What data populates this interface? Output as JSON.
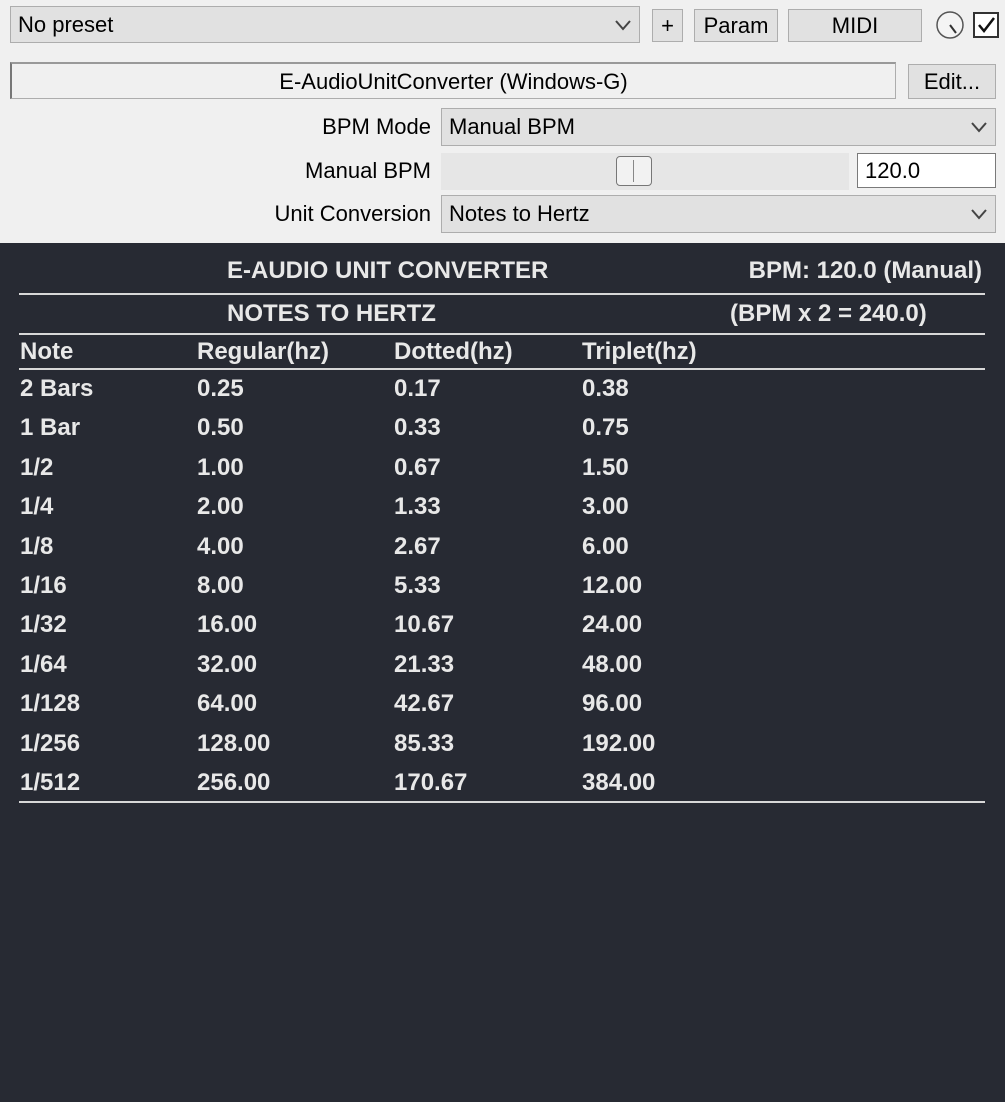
{
  "toolbar": {
    "preset": "No preset",
    "plus_label": "+",
    "param_label": "Param",
    "midi_label": "MIDI",
    "enabled": true
  },
  "plugin": {
    "name": "E-AudioUnitConverter (Windows-G)",
    "edit_label": "Edit..."
  },
  "params": {
    "bpm_mode_label": "BPM Mode",
    "bpm_mode_value": "Manual BPM",
    "manual_bpm_label": "Manual BPM",
    "manual_bpm_value": "120.0",
    "unit_conversion_label": "Unit Conversion",
    "unit_conversion_value": "Notes to Hertz"
  },
  "display": {
    "title": "E-AUDIO UNIT CONVERTER",
    "bpm_status": "BPM: 120.0 (Manual)",
    "subtitle": "NOTES TO HERTZ",
    "formula": "(BPM x 2 = 240.0)",
    "headers": [
      "Note",
      "Regular(hz)",
      "Dotted(hz)",
      "Triplet(hz)"
    ],
    "rows": [
      [
        "2 Bars",
        "0.25",
        "0.17",
        "0.38"
      ],
      [
        "1 Bar",
        "0.50",
        "0.33",
        "0.75"
      ],
      [
        "1/2",
        "1.00",
        "0.67",
        "1.50"
      ],
      [
        "1/4",
        "2.00",
        "1.33",
        "3.00"
      ],
      [
        "1/8",
        "4.00",
        "2.67",
        "6.00"
      ],
      [
        "1/16",
        "8.00",
        "5.33",
        "12.00"
      ],
      [
        "1/32",
        "16.00",
        "10.67",
        "24.00"
      ],
      [
        "1/64",
        "32.00",
        "21.33",
        "48.00"
      ],
      [
        "1/128",
        "64.00",
        "42.67",
        "96.00"
      ],
      [
        "1/256",
        "128.00",
        "85.33",
        "192.00"
      ],
      [
        "1/512",
        "256.00",
        "170.67",
        "384.00"
      ]
    ]
  },
  "colors": {
    "panel_bg": "#272a33",
    "panel_text": "#e8e8e8",
    "host_bg": "#f0f0f0"
  },
  "icons": {
    "preset_dropdown": "chevron-down-icon",
    "wet_knob": "knob-icon",
    "enable": "checkbox-checked-icon"
  }
}
